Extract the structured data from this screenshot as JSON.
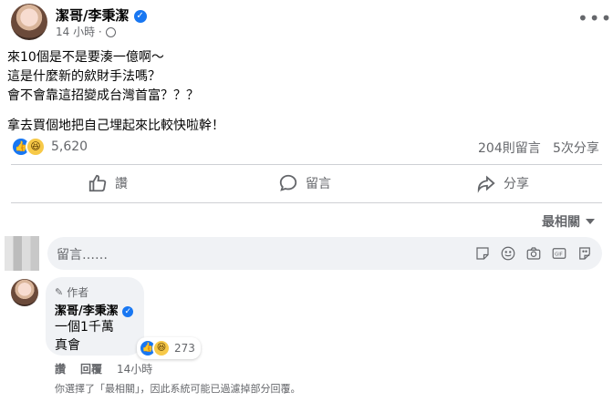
{
  "post": {
    "author": "潔哥/李秉潔",
    "time": "14 小時",
    "lines": [
      "來10個是不是要湊一億啊～",
      "這是什麼新的歛財手法嗎？",
      "會不會靠這招變成台灣首富？？？",
      "拿去買個地把自己埋起來比較快啦幹！"
    ],
    "reactions_count": "5,620",
    "comments_count": "204則留言",
    "shares_count": "5次分享"
  },
  "actions": {
    "like": "讚",
    "comment": "留言",
    "share": "分享"
  },
  "sort": {
    "label": "最相關"
  },
  "comment_input": {
    "placeholder": "留言……"
  },
  "reply": {
    "author_badge": "作者",
    "author": "潔哥/李秉潔",
    "line1": "一個1千萬",
    "line2": "真會",
    "reactions_count": "273",
    "like_label": "讚",
    "reply_label": "回覆",
    "time": "14小時"
  },
  "notice": {
    "text": "你選擇了「最相關」，因此系統可能已過濾掉部分回覆。"
  },
  "colors": {
    "facebook_blue": "#1877f2",
    "secondary_text": "#65676b",
    "input_bg": "#f0f2f5"
  },
  "icons": [
    "verified-icon",
    "more-icon",
    "like-reaction-icon",
    "haha-reaction-icon",
    "thumbs-up-icon",
    "comment-icon",
    "share-icon",
    "dropdown-icon",
    "sticker-icon",
    "emoji-icon",
    "camera-icon",
    "gif-icon",
    "avatar-sticker-icon",
    "pencil-icon"
  ]
}
